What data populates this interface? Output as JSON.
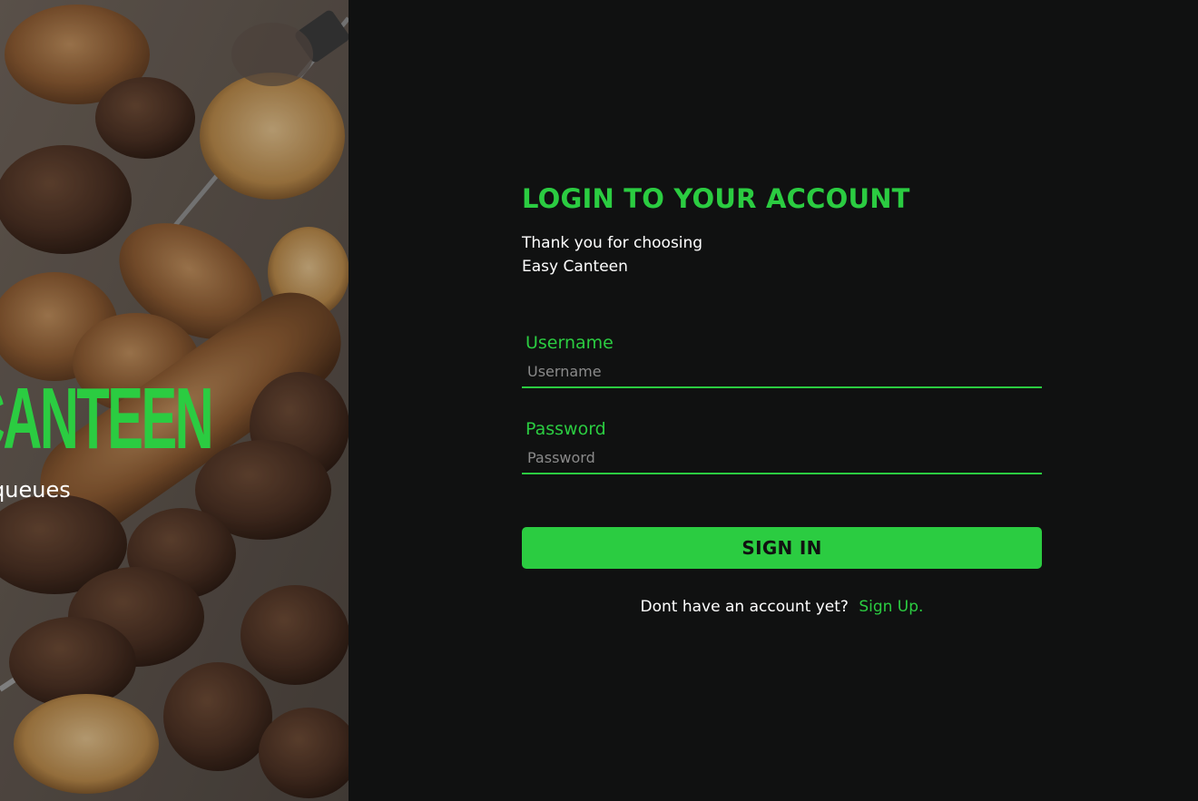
{
  "hero": {
    "title": "CANTEEN",
    "subtitle": "No more queues",
    "image": "grilled-kebab-food-photo"
  },
  "login": {
    "title": "LOGIN TO YOUR ACCOUNT",
    "subtitle_line1": "Thank you for choosing",
    "subtitle_line2": "Easy Canteen",
    "username_label": "Username",
    "username_placeholder": "Username",
    "username_value": "",
    "password_label": "Password",
    "password_placeholder": "Password",
    "password_value": "",
    "signin_label": "SIGN IN",
    "signup_prompt": "Dont have an account yet?",
    "signup_link": "Sign Up."
  },
  "colors": {
    "accent": "#2bcc41",
    "background": "#101111",
    "text": "#ffffff",
    "placeholder": "#8a8a8a"
  }
}
